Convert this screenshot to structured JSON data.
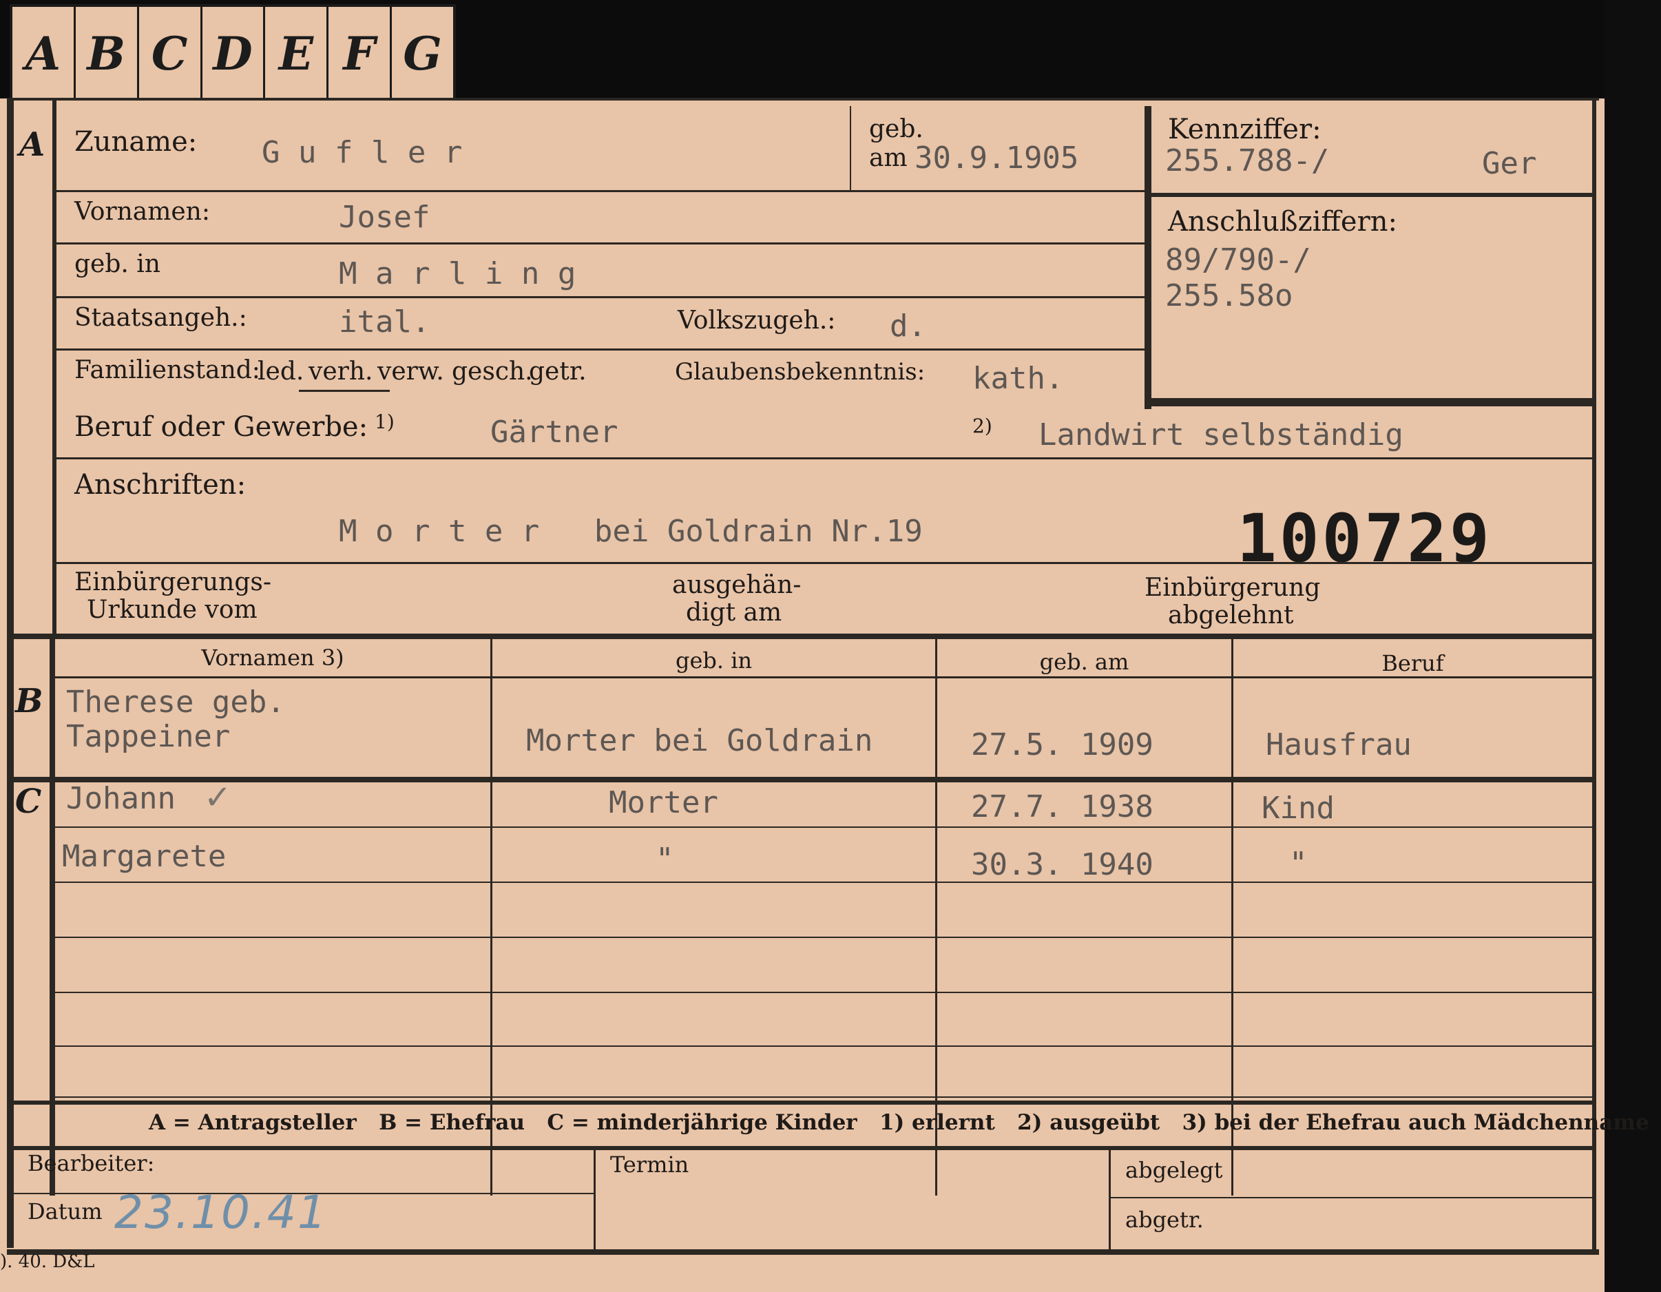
{
  "tabs": [
    "A",
    "B",
    "C",
    "D",
    "E",
    "F",
    "G"
  ],
  "sections": {
    "a": "A",
    "b": "B",
    "c": "C"
  },
  "applicant": {
    "surname_label": "Zuname:",
    "surname": "G u f l e r",
    "born_label1": "geb.",
    "born_label2": "am",
    "born_date": "30.9.1905",
    "first_label": "Vornamen:",
    "first": "Josef",
    "birthplace_label": "geb. in",
    "birthplace": "M a r l i n g",
    "citizenship_label": "Staatsangeh.:",
    "citizenship": "ital.",
    "ethnicity_label": "Volkszugeh.:",
    "ethnicity": "d.",
    "status_label": "Familienstand:",
    "status_options": [
      "led.",
      "verh.",
      "verw.",
      "gesch.",
      "getr."
    ],
    "status_selected": "verh.",
    "religion_label": "Glaubensbekenntnis:",
    "religion": "kath.",
    "occupation_label": "Beruf oder Gewerbe:",
    "occ1_marker": "1)",
    "occupation_learned": "Gärtner",
    "occ2_marker": "2)",
    "occupation_practiced": "Landwirt selbständig",
    "address_label": "Anschriften:",
    "address": "M o r t e r   bei Goldrain Nr.19",
    "number": "100729",
    "naturalization_label1": "Einbürgerungs-",
    "naturalization_label2": "Urkunde vom",
    "delivered_label1": "ausgehän-",
    "delivered_label2": "digt am",
    "rejected_label1": "Einbürgerung",
    "rejected_label2": "abgelehnt"
  },
  "ref": {
    "kennziffer_label": "Kennziffer:",
    "kennziffer": "255.788-/",
    "kennziffer_suffix": "Ger",
    "anschluss_label": "Anschlußziffern:",
    "anschluss1": "89/790-/",
    "anschluss2": "255.58o"
  },
  "family_headers": [
    "Vornamen 3)",
    "geb. in",
    "geb. am",
    "Beruf"
  ],
  "spouse": {
    "name1": "Therese geb.",
    "name2": "Tappeiner",
    "place": "Morter bei Goldrain",
    "date": "27.5. 1909",
    "job": "Hausfrau"
  },
  "children": [
    {
      "name": "Johann",
      "place": "Morter",
      "date": "27.7. 1938",
      "job": "Kind"
    },
    {
      "name": "Margarete",
      "place": "\"",
      "date": "30.3. 1940",
      "job": "\""
    }
  ],
  "check": "✓",
  "legend": "A = Antragsteller   B = Ehefrau   C = minderjährige Kinder   1) erlernt   2) ausgeübt   3) bei der Ehefrau auch Mädchenname",
  "footer": {
    "bearbeiter": "Bearbeiter:",
    "termin": "Termin",
    "abgelegt": "abgelegt",
    "datum": "Datum",
    "datum_value": "23.10.41",
    "abgetr": "abgetr."
  },
  "printmark": "). 40. D&L"
}
